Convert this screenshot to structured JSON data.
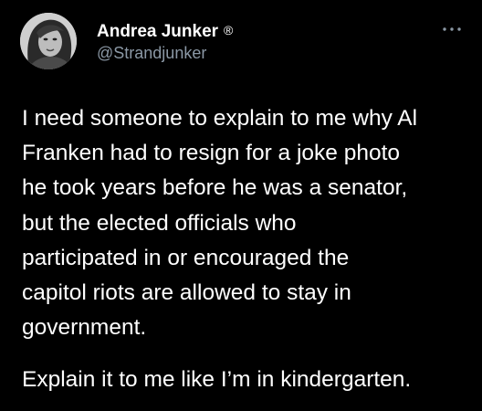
{
  "author": {
    "display_name": "Andrea Junker",
    "verified_mark": "®",
    "handle": "@Strandjunker"
  },
  "tweet": {
    "lines": [
      "I need someone to explain to me why Al",
      "Franken had to resign for a joke photo",
      "he took years before he was a senator,",
      "but the elected officials who",
      "participated in or encouraged the",
      "capitol riots are allowed to stay in",
      "government."
    ],
    "second_paragraph": "Explain it to me like I’m in kindergarten."
  },
  "icons": {
    "more": "more-dots-icon",
    "avatar": "profile-photo"
  },
  "colors": {
    "background": "#000000",
    "text": "#ffffff",
    "secondary": "#8b98a5"
  }
}
